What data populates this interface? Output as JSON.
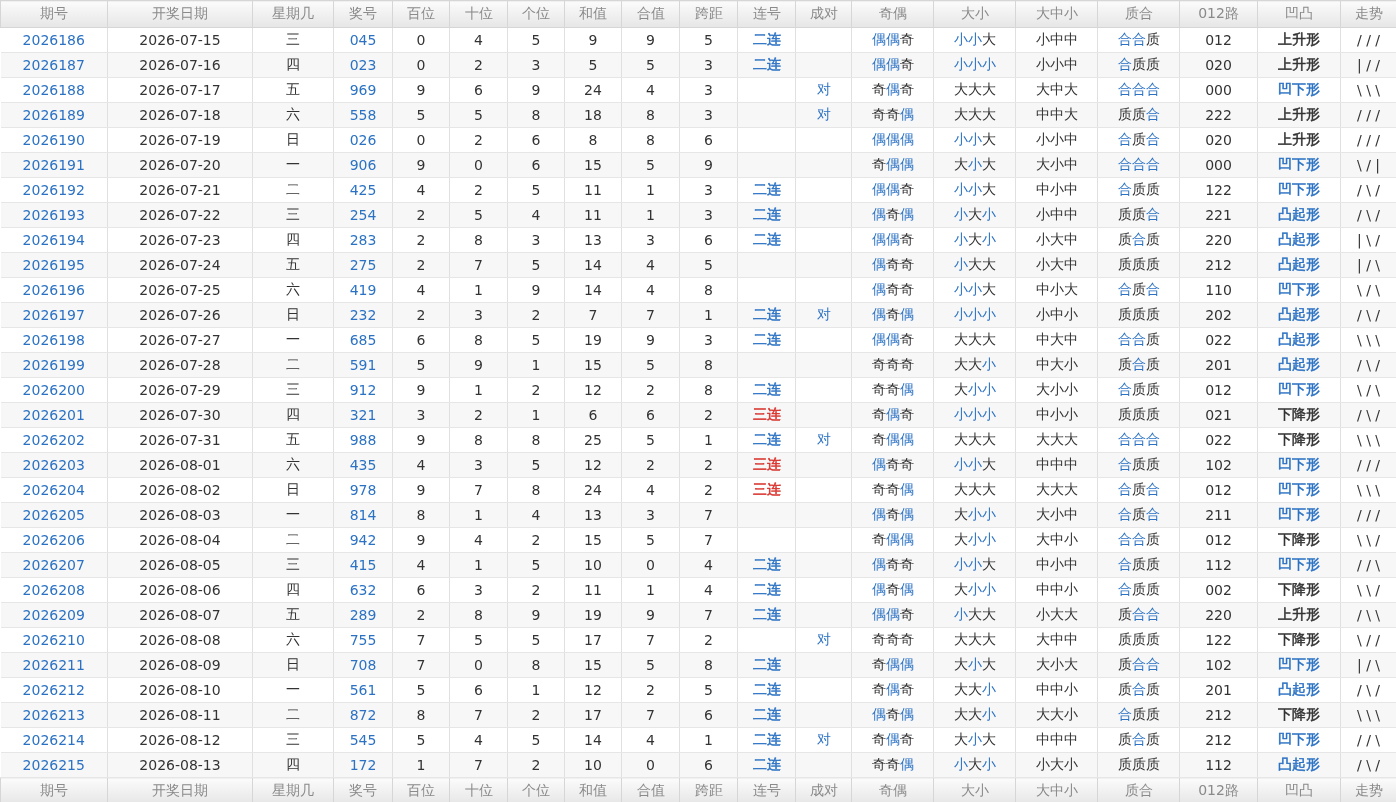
{
  "columns": [
    "期号",
    "开奖日期",
    "星期几",
    "奖号",
    "百位",
    "十位",
    "个位",
    "和值",
    "合值",
    "跨距",
    "连号",
    "成对",
    "奇偶",
    "大小",
    "大中小",
    "质合",
    "012路",
    "凹凸",
    "走势"
  ],
  "rows": [
    {
      "issue": "2026186",
      "date": "2026-07-15",
      "weekday": "三",
      "number": "045",
      "hundreds": "0",
      "tens": "4",
      "units": "5",
      "sum": "9",
      "sum_tail": "9",
      "span": "5",
      "consecutive": {
        "text": "二连",
        "color": "#2b72c4"
      },
      "odd_even": {
        "text": "偶偶奇",
        "highlight": [
          true,
          true,
          false
        ]
      },
      "size": {
        "text": "小小大",
        "highlight": [
          true,
          true,
          false
        ]
      },
      "size3": "小中中",
      "prime": {
        "text": "合合质",
        "highlight": [
          true,
          true,
          false
        ]
      },
      "route012": "012",
      "shape": {
        "text": "上升形",
        "color": "#333333"
      },
      "trend": "/ / /"
    },
    {
      "issue": "2026187",
      "date": "2026-07-16",
      "weekday": "四",
      "number": "023",
      "hundreds": "0",
      "tens": "2",
      "units": "3",
      "sum": "5",
      "sum_tail": "5",
      "span": "3",
      "consecutive": {
        "text": "二连",
        "color": "#2b72c4"
      },
      "odd_even": {
        "text": "偶偶奇",
        "highlight": [
          true,
          true,
          false
        ]
      },
      "size": {
        "text": "小小小",
        "highlight": [
          true,
          true,
          true
        ]
      },
      "size3": "小小中",
      "prime": {
        "text": "合质质",
        "highlight": [
          true,
          false,
          false
        ]
      },
      "route012": "020",
      "shape": {
        "text": "上升形",
        "color": "#333333"
      },
      "trend": "| / /"
    },
    {
      "issue": "2026188",
      "date": "2026-07-17",
      "weekday": "五",
      "number": "969",
      "hundreds": "9",
      "tens": "6",
      "units": "9",
      "sum": "24",
      "sum_tail": "4",
      "span": "3",
      "pair": "对",
      "odd_even": {
        "text": "奇偶奇",
        "highlight": [
          false,
          true,
          false
        ]
      },
      "size": {
        "text": "大大大",
        "highlight": [
          false,
          false,
          false
        ]
      },
      "size3": "大中大",
      "prime": {
        "text": "合合合",
        "highlight": [
          true,
          true,
          true
        ]
      },
      "route012": "000",
      "shape": {
        "text": "凹下形",
        "color": "#2b72c4"
      },
      "trend": "\\ \\ \\"
    },
    {
      "issue": "2026189",
      "date": "2026-07-18",
      "weekday": "六",
      "number": "558",
      "hundreds": "5",
      "tens": "5",
      "units": "8",
      "sum": "18",
      "sum_tail": "8",
      "span": "3",
      "pair": "对",
      "odd_even": {
        "text": "奇奇偶",
        "highlight": [
          false,
          false,
          true
        ]
      },
      "size": {
        "text": "大大大",
        "highlight": [
          false,
          false,
          false
        ]
      },
      "size3": "中中大",
      "prime": {
        "text": "质质合",
        "highlight": [
          false,
          false,
          true
        ]
      },
      "route012": "222",
      "shape": {
        "text": "上升形",
        "color": "#333333"
      },
      "trend": "/ / /"
    },
    {
      "issue": "2026190",
      "date": "2026-07-19",
      "weekday": "日",
      "number": "026",
      "hundreds": "0",
      "tens": "2",
      "units": "6",
      "sum": "8",
      "sum_tail": "8",
      "span": "6",
      "odd_even": {
        "text": "偶偶偶",
        "highlight": [
          true,
          true,
          true
        ]
      },
      "size": {
        "text": "小小大",
        "highlight": [
          true,
          true,
          false
        ]
      },
      "size3": "小小中",
      "prime": {
        "text": "合质合",
        "highlight": [
          true,
          false,
          true
        ]
      },
      "route012": "020",
      "shape": {
        "text": "上升形",
        "color": "#333333"
      },
      "trend": "/ / /"
    },
    {
      "issue": "2026191",
      "date": "2026-07-20",
      "weekday": "一",
      "number": "906",
      "hundreds": "9",
      "tens": "0",
      "units": "6",
      "sum": "15",
      "sum_tail": "5",
      "span": "9",
      "odd_even": {
        "text": "奇偶偶",
        "highlight": [
          false,
          true,
          true
        ]
      },
      "size": {
        "text": "大小大",
        "highlight": [
          false,
          true,
          false
        ]
      },
      "size3": "大小中",
      "prime": {
        "text": "合合合",
        "highlight": [
          true,
          true,
          true
        ]
      },
      "route012": "000",
      "shape": {
        "text": "凹下形",
        "color": "#2b72c4"
      },
      "trend": "\\ / |"
    },
    {
      "issue": "2026192",
      "date": "2026-07-21",
      "weekday": "二",
      "number": "425",
      "hundreds": "4",
      "tens": "2",
      "units": "5",
      "sum": "11",
      "sum_tail": "1",
      "span": "3",
      "consecutive": {
        "text": "二连",
        "color": "#2b72c4"
      },
      "odd_even": {
        "text": "偶偶奇",
        "highlight": [
          true,
          true,
          false
        ]
      },
      "size": {
        "text": "小小大",
        "highlight": [
          true,
          true,
          false
        ]
      },
      "size3": "中小中",
      "prime": {
        "text": "合质质",
        "highlight": [
          true,
          false,
          false
        ]
      },
      "route012": "122",
      "shape": {
        "text": "凹下形",
        "color": "#2b72c4"
      },
      "trend": "/ \\ /"
    },
    {
      "issue": "2026193",
      "date": "2026-07-22",
      "weekday": "三",
      "number": "254",
      "hundreds": "2",
      "tens": "5",
      "units": "4",
      "sum": "11",
      "sum_tail": "1",
      "span": "3",
      "consecutive": {
        "text": "二连",
        "color": "#2b72c4"
      },
      "odd_even": {
        "text": "偶奇偶",
        "highlight": [
          true,
          false,
          true
        ]
      },
      "size": {
        "text": "小大小",
        "highlight": [
          true,
          false,
          true
        ]
      },
      "size3": "小中中",
      "prime": {
        "text": "质质合",
        "highlight": [
          false,
          false,
          true
        ]
      },
      "route012": "221",
      "shape": {
        "text": "凸起形",
        "color": "#2b72c4"
      },
      "trend": "/ \\ /"
    },
    {
      "issue": "2026194",
      "date": "2026-07-23",
      "weekday": "四",
      "number": "283",
      "hundreds": "2",
      "tens": "8",
      "units": "3",
      "sum": "13",
      "sum_tail": "3",
      "span": "6",
      "consecutive": {
        "text": "二连",
        "color": "#2b72c4"
      },
      "odd_even": {
        "text": "偶偶奇",
        "highlight": [
          true,
          true,
          false
        ]
      },
      "size": {
        "text": "小大小",
        "highlight": [
          true,
          false,
          true
        ]
      },
      "size3": "小大中",
      "prime": {
        "text": "质合质",
        "highlight": [
          false,
          true,
          false
        ]
      },
      "route012": "220",
      "shape": {
        "text": "凸起形",
        "color": "#2b72c4"
      },
      "trend": "| \\ /"
    },
    {
      "issue": "2026195",
      "date": "2026-07-24",
      "weekday": "五",
      "number": "275",
      "hundreds": "2",
      "tens": "7",
      "units": "5",
      "sum": "14",
      "sum_tail": "4",
      "span": "5",
      "odd_even": {
        "text": "偶奇奇",
        "highlight": [
          true,
          false,
          false
        ]
      },
      "size": {
        "text": "小大大",
        "highlight": [
          true,
          false,
          false
        ]
      },
      "size3": "小大中",
      "prime": {
        "text": "质质质",
        "highlight": [
          false,
          false,
          false
        ]
      },
      "route012": "212",
      "shape": {
        "text": "凸起形",
        "color": "#2b72c4"
      },
      "trend": "| / \\"
    },
    {
      "issue": "2026196",
      "date": "2026-07-25",
      "weekday": "六",
      "number": "419",
      "hundreds": "4",
      "tens": "1",
      "units": "9",
      "sum": "14",
      "sum_tail": "4",
      "span": "8",
      "odd_even": {
        "text": "偶奇奇",
        "highlight": [
          true,
          false,
          false
        ]
      },
      "size": {
        "text": "小小大",
        "highlight": [
          true,
          true,
          false
        ]
      },
      "size3": "中小大",
      "prime": {
        "text": "合质合",
        "highlight": [
          true,
          false,
          true
        ]
      },
      "route012": "110",
      "shape": {
        "text": "凹下形",
        "color": "#2b72c4"
      },
      "trend": "\\ / \\"
    },
    {
      "issue": "2026197",
      "date": "2026-07-26",
      "weekday": "日",
      "number": "232",
      "hundreds": "2",
      "tens": "3",
      "units": "2",
      "sum": "7",
      "sum_tail": "7",
      "span": "1",
      "consecutive": {
        "text": "二连",
        "color": "#2b72c4"
      },
      "pair": "对",
      "odd_even": {
        "text": "偶奇偶",
        "highlight": [
          true,
          false,
          true
        ]
      },
      "size": {
        "text": "小小小",
        "highlight": [
          true,
          true,
          true
        ]
      },
      "size3": "小中小",
      "prime": {
        "text": "质质质",
        "highlight": [
          false,
          false,
          false
        ]
      },
      "route012": "202",
      "shape": {
        "text": "凸起形",
        "color": "#2b72c4"
      },
      "trend": "/ \\ /"
    },
    {
      "issue": "2026198",
      "date": "2026-07-27",
      "weekday": "一",
      "number": "685",
      "hundreds": "6",
      "tens": "8",
      "units": "5",
      "sum": "19",
      "sum_tail": "9",
      "span": "3",
      "consecutive": {
        "text": "二连",
        "color": "#2b72c4"
      },
      "odd_even": {
        "text": "偶偶奇",
        "highlight": [
          true,
          true,
          false
        ]
      },
      "size": {
        "text": "大大大",
        "highlight": [
          false,
          false,
          false
        ]
      },
      "size3": "中大中",
      "prime": {
        "text": "合合质",
        "highlight": [
          true,
          true,
          false
        ]
      },
      "route012": "022",
      "shape": {
        "text": "凸起形",
        "color": "#2b72c4"
      },
      "trend": "\\ \\ \\"
    },
    {
      "issue": "2026199",
      "date": "2026-07-28",
      "weekday": "二",
      "number": "591",
      "hundreds": "5",
      "tens": "9",
      "units": "1",
      "sum": "15",
      "sum_tail": "5",
      "span": "8",
      "odd_even": {
        "text": "奇奇奇",
        "highlight": [
          false,
          false,
          false
        ]
      },
      "size": {
        "text": "大大小",
        "highlight": [
          false,
          false,
          true
        ]
      },
      "size3": "中大小",
      "prime": {
        "text": "质合质",
        "highlight": [
          false,
          true,
          false
        ]
      },
      "route012": "201",
      "shape": {
        "text": "凸起形",
        "color": "#2b72c4"
      },
      "trend": "/ \\ /"
    },
    {
      "issue": "2026200",
      "date": "2026-07-29",
      "weekday": "三",
      "number": "912",
      "hundreds": "9",
      "tens": "1",
      "units": "2",
      "sum": "12",
      "sum_tail": "2",
      "span": "8",
      "consecutive": {
        "text": "二连",
        "color": "#2b72c4"
      },
      "odd_even": {
        "text": "奇奇偶",
        "highlight": [
          false,
          false,
          true
        ]
      },
      "size": {
        "text": "大小小",
        "highlight": [
          false,
          true,
          true
        ]
      },
      "size3": "大小小",
      "prime": {
        "text": "合质质",
        "highlight": [
          true,
          false,
          false
        ]
      },
      "route012": "012",
      "shape": {
        "text": "凹下形",
        "color": "#2b72c4"
      },
      "trend": "\\ / \\"
    },
    {
      "issue": "2026201",
      "date": "2026-07-30",
      "weekday": "四",
      "number": "321",
      "hundreds": "3",
      "tens": "2",
      "units": "1",
      "sum": "6",
      "sum_tail": "6",
      "span": "2",
      "consecutive": {
        "text": "三连",
        "color": "#d9312b"
      },
      "odd_even": {
        "text": "奇偶奇",
        "highlight": [
          false,
          true,
          false
        ]
      },
      "size": {
        "text": "小小小",
        "highlight": [
          true,
          true,
          true
        ]
      },
      "size3": "中小小",
      "prime": {
        "text": "质质质",
        "highlight": [
          false,
          false,
          false
        ]
      },
      "route012": "021",
      "shape": {
        "text": "下降形",
        "color": "#333333"
      },
      "trend": "/ \\ /"
    },
    {
      "issue": "2026202",
      "date": "2026-07-31",
      "weekday": "五",
      "number": "988",
      "hundreds": "9",
      "tens": "8",
      "units": "8",
      "sum": "25",
      "sum_tail": "5",
      "span": "1",
      "consecutive": {
        "text": "二连",
        "color": "#2b72c4"
      },
      "pair": "对",
      "odd_even": {
        "text": "奇偶偶",
        "highlight": [
          false,
          true,
          true
        ]
      },
      "size": {
        "text": "大大大",
        "highlight": [
          false,
          false,
          false
        ]
      },
      "size3": "大大大",
      "prime": {
        "text": "合合合",
        "highlight": [
          true,
          true,
          true
        ]
      },
      "route012": "022",
      "shape": {
        "text": "下降形",
        "color": "#333333"
      },
      "trend": "\\ \\ \\"
    },
    {
      "issue": "2026203",
      "date": "2026-08-01",
      "weekday": "六",
      "number": "435",
      "hundreds": "4",
      "tens": "3",
      "units": "5",
      "sum": "12",
      "sum_tail": "2",
      "span": "2",
      "consecutive": {
        "text": "三连",
        "color": "#d9312b"
      },
      "odd_even": {
        "text": "偶奇奇",
        "highlight": [
          true,
          false,
          false
        ]
      },
      "size": {
        "text": "小小大",
        "highlight": [
          true,
          true,
          false
        ]
      },
      "size3": "中中中",
      "prime": {
        "text": "合质质",
        "highlight": [
          true,
          false,
          false
        ]
      },
      "route012": "102",
      "shape": {
        "text": "凹下形",
        "color": "#2b72c4"
      },
      "trend": "/ / /"
    },
    {
      "issue": "2026204",
      "date": "2026-08-02",
      "weekday": "日",
      "number": "978",
      "hundreds": "9",
      "tens": "7",
      "units": "8",
      "sum": "24",
      "sum_tail": "4",
      "span": "2",
      "consecutive": {
        "text": "三连",
        "color": "#d9312b"
      },
      "odd_even": {
        "text": "奇奇偶",
        "highlight": [
          false,
          false,
          true
        ]
      },
      "size": {
        "text": "大大大",
        "highlight": [
          false,
          false,
          false
        ]
      },
      "size3": "大大大",
      "prime": {
        "text": "合质合",
        "highlight": [
          true,
          false,
          true
        ]
      },
      "route012": "012",
      "shape": {
        "text": "凹下形",
        "color": "#2b72c4"
      },
      "trend": "\\ \\ \\"
    },
    {
      "issue": "2026205",
      "date": "2026-08-03",
      "weekday": "一",
      "number": "814",
      "hundreds": "8",
      "tens": "1",
      "units": "4",
      "sum": "13",
      "sum_tail": "3",
      "span": "7",
      "odd_even": {
        "text": "偶奇偶",
        "highlight": [
          true,
          false,
          true
        ]
      },
      "size": {
        "text": "大小小",
        "highlight": [
          false,
          true,
          true
        ]
      },
      "size3": "大小中",
      "prime": {
        "text": "合质合",
        "highlight": [
          true,
          false,
          true
        ]
      },
      "route012": "211",
      "shape": {
        "text": "凹下形",
        "color": "#2b72c4"
      },
      "trend": "/ / /"
    },
    {
      "issue": "2026206",
      "date": "2026-08-04",
      "weekday": "二",
      "number": "942",
      "hundreds": "9",
      "tens": "4",
      "units": "2",
      "sum": "15",
      "sum_tail": "5",
      "span": "7",
      "odd_even": {
        "text": "奇偶偶",
        "highlight": [
          false,
          true,
          true
        ]
      },
      "size": {
        "text": "大小小",
        "highlight": [
          false,
          true,
          true
        ]
      },
      "size3": "大中小",
      "prime": {
        "text": "合合质",
        "highlight": [
          true,
          true,
          false
        ]
      },
      "route012": "012",
      "shape": {
        "text": "下降形",
        "color": "#333333"
      },
      "trend": "\\ \\ /"
    },
    {
      "issue": "2026207",
      "date": "2026-08-05",
      "weekday": "三",
      "number": "415",
      "hundreds": "4",
      "tens": "1",
      "units": "5",
      "sum": "10",
      "sum_tail": "0",
      "span": "4",
      "consecutive": {
        "text": "二连",
        "color": "#2b72c4"
      },
      "odd_even": {
        "text": "偶奇奇",
        "highlight": [
          true,
          false,
          false
        ]
      },
      "size": {
        "text": "小小大",
        "highlight": [
          true,
          true,
          false
        ]
      },
      "size3": "中小中",
      "prime": {
        "text": "合质质",
        "highlight": [
          true,
          false,
          false
        ]
      },
      "route012": "112",
      "shape": {
        "text": "凹下形",
        "color": "#2b72c4"
      },
      "trend": "/ / \\"
    },
    {
      "issue": "2026208",
      "date": "2026-08-06",
      "weekday": "四",
      "number": "632",
      "hundreds": "6",
      "tens": "3",
      "units": "2",
      "sum": "11",
      "sum_tail": "1",
      "span": "4",
      "consecutive": {
        "text": "二连",
        "color": "#2b72c4"
      },
      "odd_even": {
        "text": "偶奇偶",
        "highlight": [
          true,
          false,
          true
        ]
      },
      "size": {
        "text": "大小小",
        "highlight": [
          false,
          true,
          true
        ]
      },
      "size3": "中中小",
      "prime": {
        "text": "合质质",
        "highlight": [
          true,
          false,
          false
        ]
      },
      "route012": "002",
      "shape": {
        "text": "下降形",
        "color": "#333333"
      },
      "trend": "\\ \\ /"
    },
    {
      "issue": "2026209",
      "date": "2026-08-07",
      "weekday": "五",
      "number": "289",
      "hundreds": "2",
      "tens": "8",
      "units": "9",
      "sum": "19",
      "sum_tail": "9",
      "span": "7",
      "consecutive": {
        "text": "二连",
        "color": "#2b72c4"
      },
      "odd_even": {
        "text": "偶偶奇",
        "highlight": [
          true,
          true,
          false
        ]
      },
      "size": {
        "text": "小大大",
        "highlight": [
          true,
          false,
          false
        ]
      },
      "size3": "小大大",
      "prime": {
        "text": "质合合",
        "highlight": [
          false,
          true,
          true
        ]
      },
      "route012": "220",
      "shape": {
        "text": "上升形",
        "color": "#333333"
      },
      "trend": "/ \\ \\"
    },
    {
      "issue": "2026210",
      "date": "2026-08-08",
      "weekday": "六",
      "number": "755",
      "hundreds": "7",
      "tens": "5",
      "units": "5",
      "sum": "17",
      "sum_tail": "7",
      "span": "2",
      "pair": "对",
      "odd_even": {
        "text": "奇奇奇",
        "highlight": [
          false,
          false,
          false
        ]
      },
      "size": {
        "text": "大大大",
        "highlight": [
          false,
          false,
          false
        ]
      },
      "size3": "大中中",
      "prime": {
        "text": "质质质",
        "highlight": [
          false,
          false,
          false
        ]
      },
      "route012": "122",
      "shape": {
        "text": "下降形",
        "color": "#333333"
      },
      "trend": "\\ / /"
    },
    {
      "issue": "2026211",
      "date": "2026-08-09",
      "weekday": "日",
      "number": "708",
      "hundreds": "7",
      "tens": "0",
      "units": "8",
      "sum": "15",
      "sum_tail": "5",
      "span": "8",
      "consecutive": {
        "text": "二连",
        "color": "#2b72c4"
      },
      "odd_even": {
        "text": "奇偶偶",
        "highlight": [
          false,
          true,
          true
        ]
      },
      "size": {
        "text": "大小大",
        "highlight": [
          false,
          true,
          false
        ]
      },
      "size3": "大小大",
      "prime": {
        "text": "质合合",
        "highlight": [
          false,
          true,
          true
        ]
      },
      "route012": "102",
      "shape": {
        "text": "凹下形",
        "color": "#2b72c4"
      },
      "trend": "| / \\"
    },
    {
      "issue": "2026212",
      "date": "2026-08-10",
      "weekday": "一",
      "number": "561",
      "hundreds": "5",
      "tens": "6",
      "units": "1",
      "sum": "12",
      "sum_tail": "2",
      "span": "5",
      "consecutive": {
        "text": "二连",
        "color": "#2b72c4"
      },
      "odd_even": {
        "text": "奇偶奇",
        "highlight": [
          false,
          true,
          false
        ]
      },
      "size": {
        "text": "大大小",
        "highlight": [
          false,
          false,
          true
        ]
      },
      "size3": "中中小",
      "prime": {
        "text": "质合质",
        "highlight": [
          false,
          true,
          false
        ]
      },
      "route012": "201",
      "shape": {
        "text": "凸起形",
        "color": "#2b72c4"
      },
      "trend": "/ \\ /"
    },
    {
      "issue": "2026213",
      "date": "2026-08-11",
      "weekday": "二",
      "number": "872",
      "hundreds": "8",
      "tens": "7",
      "units": "2",
      "sum": "17",
      "sum_tail": "7",
      "span": "6",
      "consecutive": {
        "text": "二连",
        "color": "#2b72c4"
      },
      "odd_even": {
        "text": "偶奇偶",
        "highlight": [
          true,
          false,
          true
        ]
      },
      "size": {
        "text": "大大小",
        "highlight": [
          false,
          false,
          true
        ]
      },
      "size3": "大大小",
      "prime": {
        "text": "合质质",
        "highlight": [
          true,
          false,
          false
        ]
      },
      "route012": "212",
      "shape": {
        "text": "下降形",
        "color": "#333333"
      },
      "trend": "\\ \\ \\"
    },
    {
      "issue": "2026214",
      "date": "2026-08-12",
      "weekday": "三",
      "number": "545",
      "hundreds": "5",
      "tens": "4",
      "units": "5",
      "sum": "14",
      "sum_tail": "4",
      "span": "1",
      "consecutive": {
        "text": "二连",
        "color": "#2b72c4"
      },
      "pair": "对",
      "odd_even": {
        "text": "奇偶奇",
        "highlight": [
          false,
          true,
          false
        ]
      },
      "size": {
        "text": "大小大",
        "highlight": [
          false,
          true,
          false
        ]
      },
      "size3": "中中中",
      "prime": {
        "text": "质合质",
        "highlight": [
          false,
          true,
          false
        ]
      },
      "route012": "212",
      "shape": {
        "text": "凹下形",
        "color": "#2b72c4"
      },
      "trend": "/ / \\"
    },
    {
      "issue": "2026215",
      "date": "2026-08-13",
      "weekday": "四",
      "number": "172",
      "hundreds": "1",
      "tens": "7",
      "units": "2",
      "sum": "10",
      "sum_tail": "0",
      "span": "6",
      "consecutive": {
        "text": "二连",
        "color": "#2b72c4"
      },
      "odd_even": {
        "text": "奇奇偶",
        "highlight": [
          false,
          false,
          true
        ]
      },
      "size": {
        "text": "小大小",
        "highlight": [
          true,
          false,
          true
        ]
      },
      "size3": "小大小",
      "prime": {
        "text": "质质质",
        "highlight": [
          false,
          false,
          false
        ]
      },
      "route012": "112",
      "shape": {
        "text": "凸起形",
        "color": "#2b72c4"
      },
      "trend": "/ \\ /"
    }
  ],
  "footer_columns": [
    "期号",
    "开奖日期",
    "星期几",
    "奖号",
    "百位",
    "十位",
    "个位",
    "和值",
    "合值",
    "跨距",
    "连号",
    "成对",
    "奇偶",
    "大小",
    "大中小",
    "质合",
    "012路",
    "凹凸",
    "走势"
  ]
}
